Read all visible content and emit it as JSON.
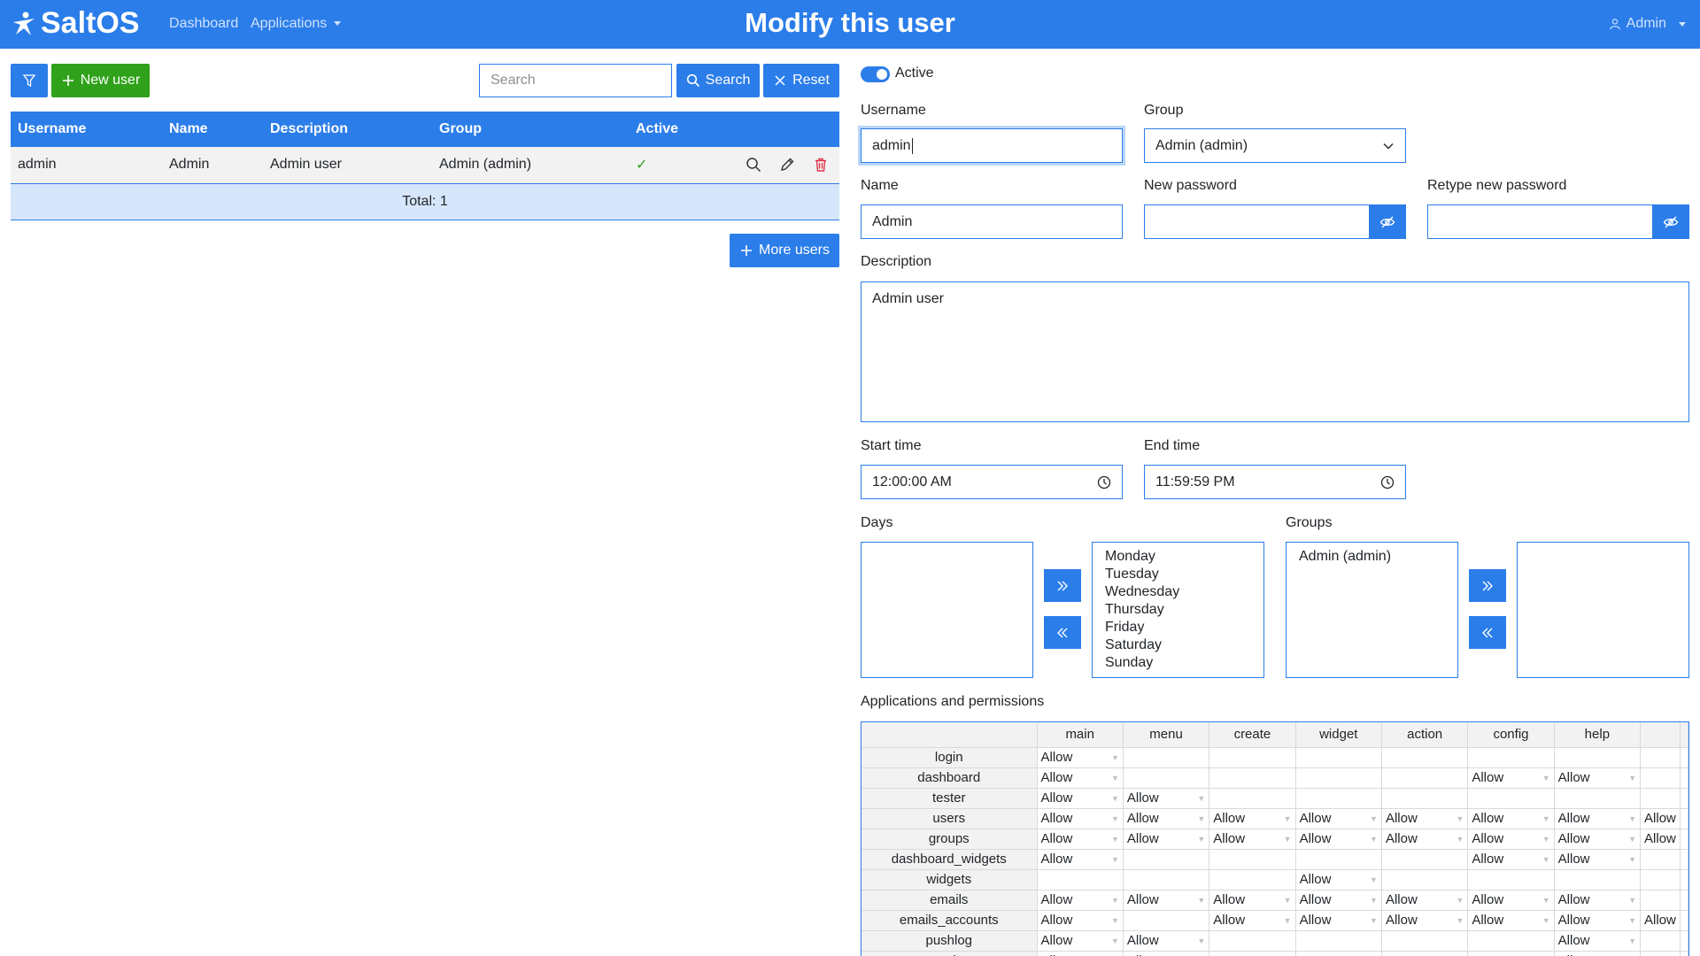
{
  "header": {
    "brand": "SaltOS",
    "nav": {
      "dashboard": "Dashboard",
      "applications": "Applications"
    },
    "title": "Modify this user",
    "user_menu": "Admin"
  },
  "list": {
    "new_user": "New user",
    "search_placeholder": "Search",
    "search_button": "Search",
    "reset_button": "Reset",
    "columns": [
      "Username",
      "Name",
      "Description",
      "Group",
      "Active"
    ],
    "rows": [
      {
        "username": "admin",
        "name": "Admin",
        "description": "Admin user",
        "group": "Admin (admin)",
        "active": "✓"
      }
    ],
    "total": "Total: 1",
    "more_users": "More users"
  },
  "form": {
    "active_label": "Active",
    "username_label": "Username",
    "username_value": "admin",
    "group_label": "Group",
    "group_value": "Admin (admin)",
    "name_label": "Name",
    "name_value": "Admin",
    "new_password_label": "New password",
    "retype_password_label": "Retype new password",
    "description_label": "Description",
    "description_value": "Admin user",
    "start_time_label": "Start time",
    "start_time_value": "12:00:00 AM",
    "end_time_label": "End time",
    "end_time_value": "11:59:59 PM",
    "days_label": "Days",
    "days_selected": [
      "Monday",
      "Tuesday",
      "Wednesday",
      "Thursday",
      "Friday",
      "Saturday",
      "Sunday"
    ],
    "groups_label": "Groups",
    "groups_available": [
      "Admin (admin)"
    ],
    "permissions_label": "Applications and permissions"
  },
  "permissions": {
    "columns": [
      "main",
      "menu",
      "create",
      "widget",
      "action",
      "config",
      "help",
      ""
    ],
    "rows": [
      {
        "app": "login",
        "cells": [
          "Allow",
          "",
          "",
          "",
          "",
          "",
          "",
          ""
        ]
      },
      {
        "app": "dashboard",
        "cells": [
          "Allow",
          "",
          "",
          "",
          "",
          "Allow",
          "Allow",
          ""
        ]
      },
      {
        "app": "tester",
        "cells": [
          "Allow",
          "Allow",
          "",
          "",
          "",
          "",
          "",
          ""
        ]
      },
      {
        "app": "users",
        "cells": [
          "Allow",
          "Allow",
          "Allow",
          "Allow",
          "Allow",
          "Allow",
          "Allow",
          "Allow"
        ]
      },
      {
        "app": "groups",
        "cells": [
          "Allow",
          "Allow",
          "Allow",
          "Allow",
          "Allow",
          "Allow",
          "Allow",
          "Allow"
        ]
      },
      {
        "app": "dashboard_widgets",
        "cells": [
          "Allow",
          "",
          "",
          "",
          "",
          "Allow",
          "Allow",
          ""
        ]
      },
      {
        "app": "widgets",
        "cells": [
          "",
          "",
          "",
          "Allow",
          "",
          "",
          "",
          ""
        ]
      },
      {
        "app": "emails",
        "cells": [
          "Allow",
          "Allow",
          "Allow",
          "Allow",
          "Allow",
          "Allow",
          "Allow",
          ""
        ]
      },
      {
        "app": "emails_accounts",
        "cells": [
          "Allow",
          "",
          "Allow",
          "Allow",
          "Allow",
          "Allow",
          "Allow",
          "Allow"
        ]
      },
      {
        "app": "pushlog",
        "cells": [
          "Allow",
          "Allow",
          "",
          "",
          "",
          "",
          "Allow",
          ""
        ]
      },
      {
        "app": "croplog",
        "cells": [
          "Allow",
          "Allow",
          "",
          "",
          "",
          "",
          "Allow",
          ""
        ]
      }
    ]
  },
  "colors": {
    "primary": "#2b7de9",
    "success": "#2fa11a",
    "danger": "#dc3545"
  }
}
